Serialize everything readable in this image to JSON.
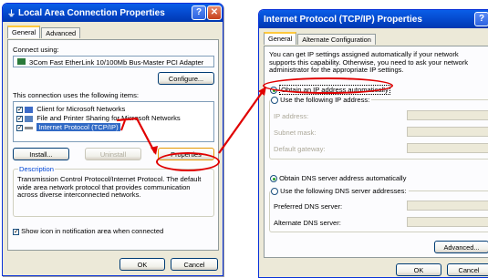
{
  "left_window": {
    "title": "Local Area Connection Properties",
    "help_button": "?",
    "close_button": "✕",
    "tabs": [
      "General",
      "Advanced"
    ],
    "connect_using_label": "Connect using:",
    "adapter_name": "3Com Fast EtherLink 10/100Mb Bus-Master PCI Adapter",
    "configure_button": "Configure...",
    "items_label": "This connection uses the following items:",
    "items": [
      {
        "label": "Client for Microsoft Networks",
        "checked": true
      },
      {
        "label": "File and Printer Sharing for Microsoft Networks",
        "checked": true
      },
      {
        "label": "Internet Protocol (TCP/IP)",
        "checked": true
      }
    ],
    "install_button": "Install...",
    "uninstall_button": "Uninstall",
    "properties_button": "Properties",
    "description_label": "Description",
    "description_text": "Transmission Control Protocol/Internet Protocol. The default wide area network protocol that provides communication across diverse interconnected networks.",
    "show_icon_label": "Show icon in notification area when connected",
    "ok_button": "OK",
    "cancel_button": "Cancel"
  },
  "right_window": {
    "title": "Internet Protocol (TCP/IP) Properties",
    "help_button": "?",
    "tabs": [
      "General",
      "Alternate Configuration"
    ],
    "intro_text": "You can get IP settings assigned automatically if your network supports this capability. Otherwise, you need to ask your network administrator for the appropriate IP settings.",
    "obtain_ip_auto": "Obtain an IP address automatically",
    "use_following_ip": "Use the following IP address:",
    "ip_address_label": "IP address:",
    "subnet_mask_label": "Subnet mask:",
    "default_gateway_label": "Default gateway:",
    "obtain_dns_auto": "Obtain DNS server address automatically",
    "use_following_dns": "Use the following DNS server addresses:",
    "preferred_dns_label": "Preferred DNS server:",
    "alternate_dns_label": "Alternate DNS server:",
    "advanced_button": "Advanced...",
    "ok_button": "OK",
    "cancel_button": "Cancel"
  },
  "colors": {
    "highlight": "#e00000",
    "title_bar": "#0446c9",
    "selection": "#316ac5"
  }
}
